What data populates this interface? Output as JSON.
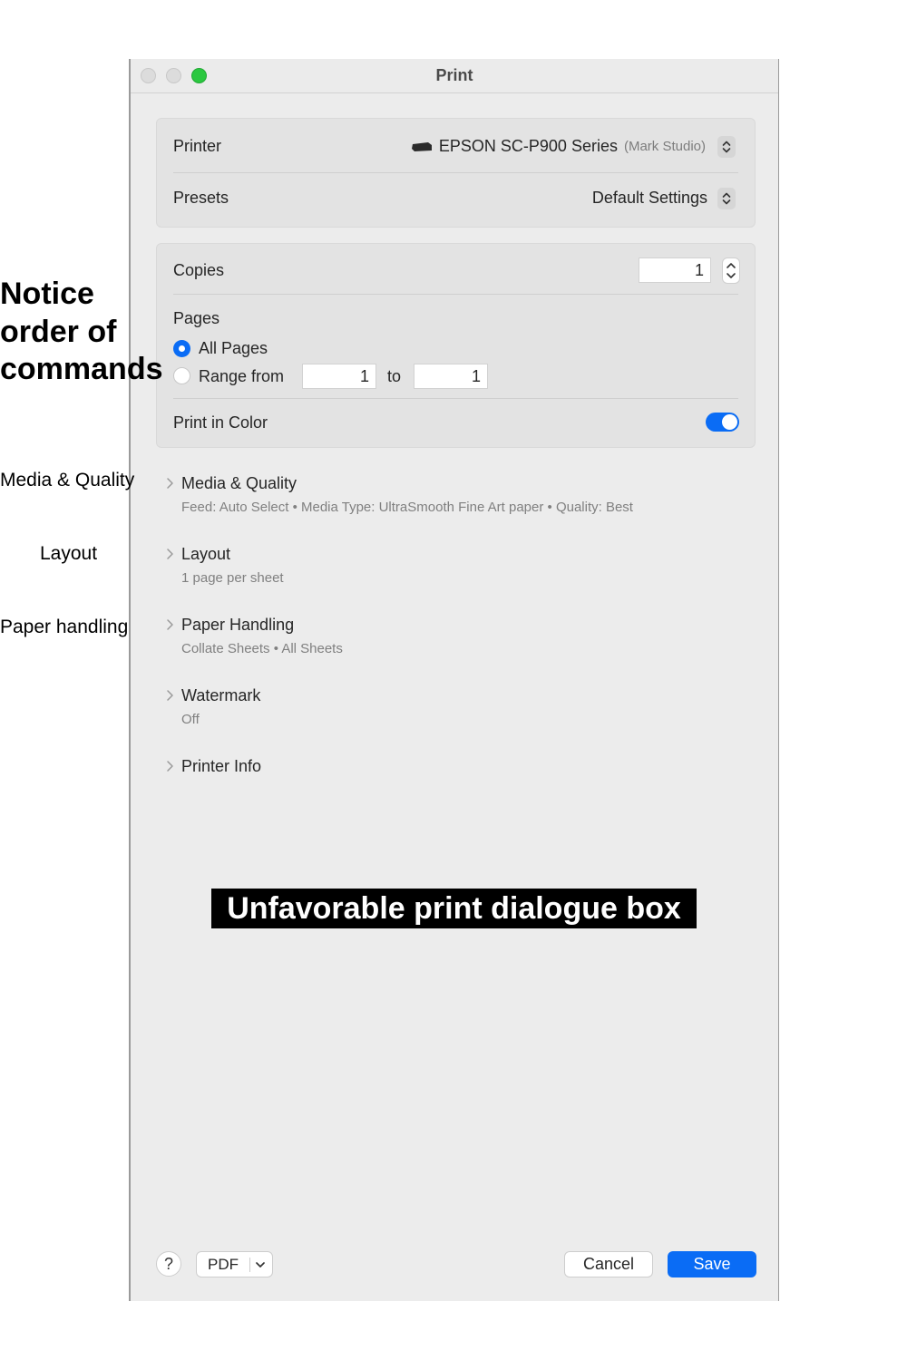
{
  "annotations": {
    "notice": "Notice order of commands",
    "media_quality": "Media & Quality",
    "layout": "Layout",
    "paper_handling": "Paper handling"
  },
  "window": {
    "title": "Print"
  },
  "printer": {
    "label": "Printer",
    "name": "EPSON SC-P900 Series",
    "location": "(Mark Studio)"
  },
  "presets": {
    "label": "Presets",
    "value": "Default Settings"
  },
  "copies": {
    "label": "Copies",
    "value": "1"
  },
  "pages": {
    "label": "Pages",
    "all_pages_label": "All Pages",
    "range_label": "Range from",
    "range_from": "1",
    "to_label": "to",
    "range_to": "1",
    "selected": "All Pages"
  },
  "print_in_color": {
    "label": "Print in Color",
    "enabled": true
  },
  "sections": [
    {
      "title": "Media & Quality",
      "subtitle": "Feed: Auto Select • Media Type: UltraSmooth Fine Art paper • Quality: Best"
    },
    {
      "title": "Layout",
      "subtitle": "1 page per sheet"
    },
    {
      "title": "Paper Handling",
      "subtitle": "Collate Sheets • All Sheets"
    },
    {
      "title": "Watermark",
      "subtitle": "Off"
    },
    {
      "title": "Printer Info",
      "subtitle": ""
    }
  ],
  "banner": "Unfavorable print dialogue box",
  "footer": {
    "help": "?",
    "pdf": "PDF",
    "cancel": "Cancel",
    "save": "Save"
  },
  "colors": {
    "accent": "#0a6cf5",
    "window_bg": "#ececec",
    "zoom_light": "#2bc840"
  }
}
